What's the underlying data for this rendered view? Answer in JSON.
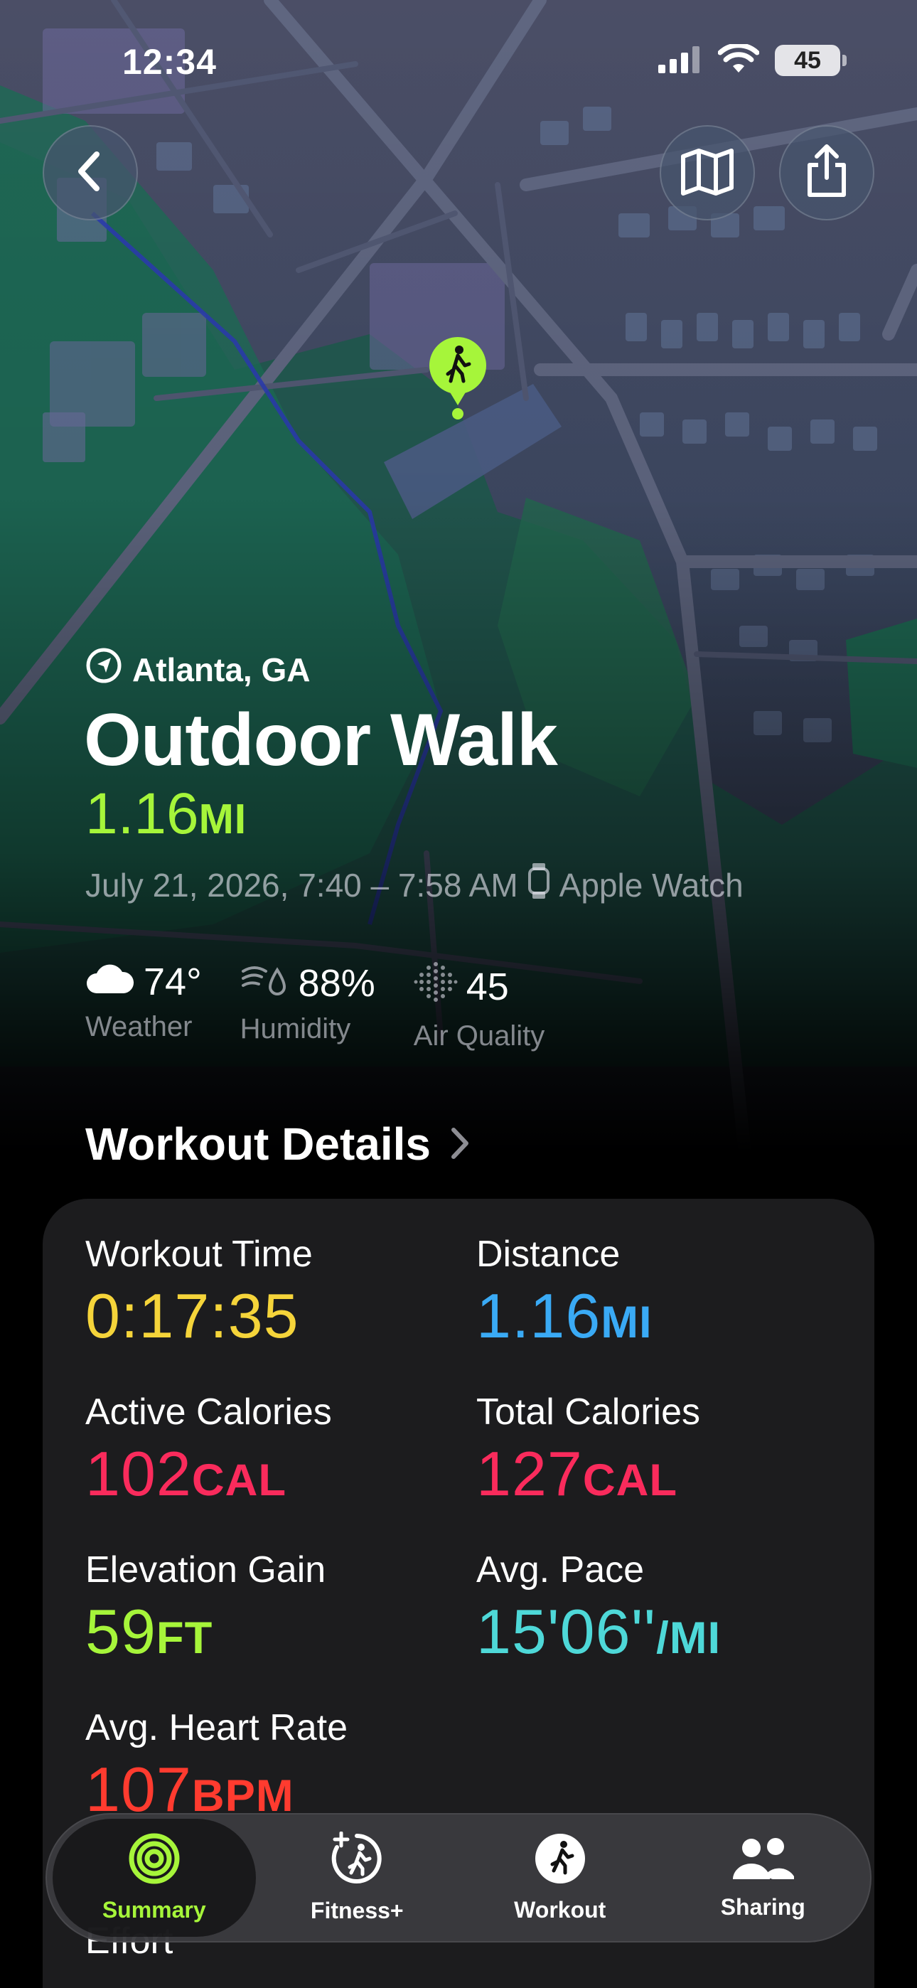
{
  "status_bar": {
    "time": "12:34",
    "battery": "45"
  },
  "nav": {
    "back": "chevron-left-icon",
    "map": "map-icon",
    "share": "share-icon"
  },
  "workout": {
    "location": "Atlanta, GA",
    "title": "Outdoor Walk",
    "distance_value": "1.16",
    "distance_unit": "MI",
    "date_time": "July 21, 2026, 7:40 – 7:58 AM",
    "device": "Apple Watch"
  },
  "conditions": [
    {
      "value": "74°",
      "label": "Weather",
      "icon": "cloud-icon"
    },
    {
      "value": "88%",
      "label": "Humidity",
      "icon": "humidity-icon"
    },
    {
      "value": "45",
      "label": "Air Quality",
      "icon": "air-quality-icon"
    }
  ],
  "details": {
    "heading": "Workout Details",
    "metrics": [
      {
        "label": "Workout Time",
        "value": "0:17:35",
        "unit": "",
        "color": "#f5d43a"
      },
      {
        "label": "Distance",
        "value": "1.16",
        "unit": "MI",
        "color": "#3aaaf5"
      },
      {
        "label": "Active Calories",
        "value": "102",
        "unit": "CAL",
        "color": "#fa2b5c"
      },
      {
        "label": "Total Calories",
        "value": "127",
        "unit": "CAL",
        "color": "#fa2b5c"
      },
      {
        "label": "Elevation Gain",
        "value": "59",
        "unit": "FT",
        "color": "#a6f53a"
      },
      {
        "label": "Avg. Pace",
        "value": "15'06''",
        "unit": "/MI",
        "color": "#4ed8d8"
      },
      {
        "label": "Avg. Heart Rate",
        "value": "107",
        "unit": "BPM",
        "color": "#ff3b2f"
      }
    ],
    "peek_label": "Effort"
  },
  "tabs": [
    {
      "label": "Summary",
      "icon": "activity-rings-icon",
      "active": true
    },
    {
      "label": "Fitness+",
      "icon": "fitness-plus-icon",
      "active": false
    },
    {
      "label": "Workout",
      "icon": "workout-runner-icon",
      "active": false
    },
    {
      "label": "Sharing",
      "icon": "sharing-people-icon",
      "active": false
    }
  ],
  "colors": {
    "accent_green": "#a6f53a",
    "card_bg": "#1c1c1e"
  }
}
